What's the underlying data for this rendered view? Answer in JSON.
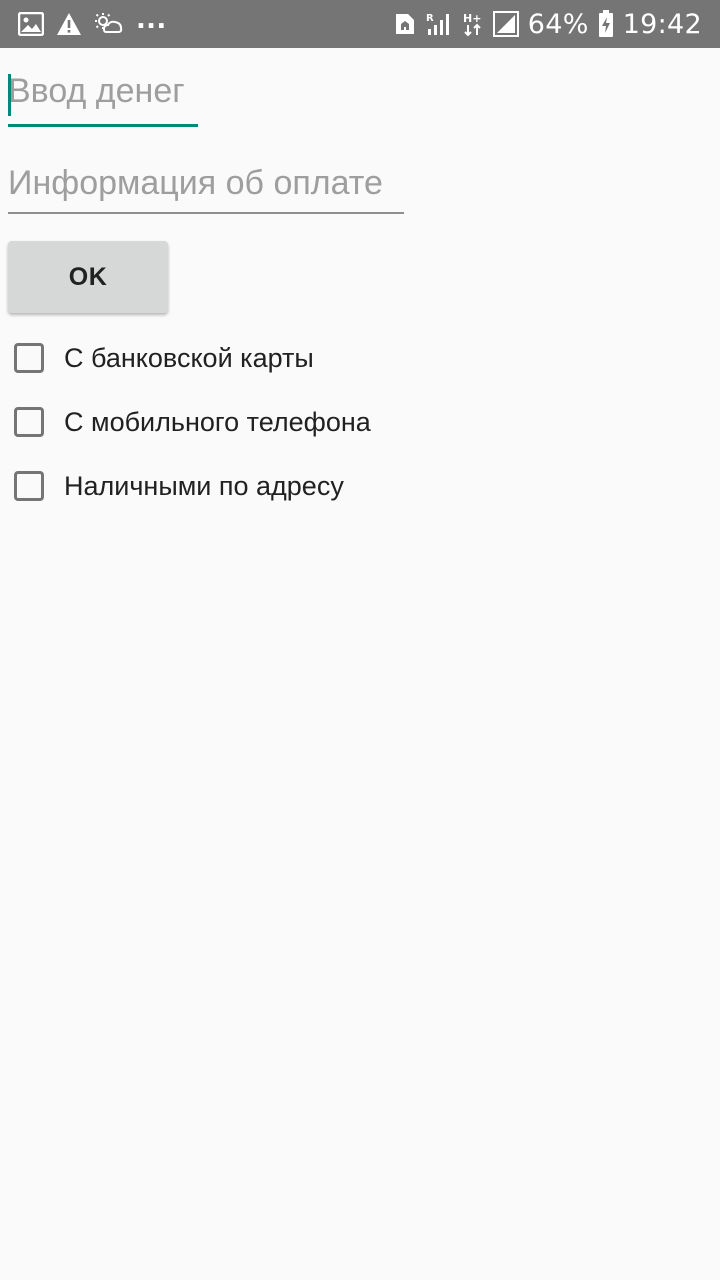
{
  "status_bar": {
    "left_icons": [
      "image-icon",
      "warning-icon",
      "weather-icon"
    ],
    "more_indicator": "...",
    "right_icons": [
      "sim-icon",
      "signal-r-icon",
      "network-h-plus-icon",
      "signal-icon"
    ],
    "battery_percent": "64%",
    "time": "19:42"
  },
  "form": {
    "amount_input": {
      "value": "",
      "placeholder": "Ввод денег"
    },
    "payment_info_input": {
      "value": "",
      "placeholder": "Информация об оплате"
    },
    "ok_button": "OK",
    "payment_options": [
      {
        "label": "С банковской карты",
        "checked": false
      },
      {
        "label": "С мобильного телефона",
        "checked": false
      },
      {
        "label": "Наличными по адресу",
        "checked": false
      }
    ]
  },
  "colors": {
    "accent": "#00897b",
    "status_bar": "#757575",
    "background": "#fafafa",
    "button": "#d6d7d7"
  }
}
